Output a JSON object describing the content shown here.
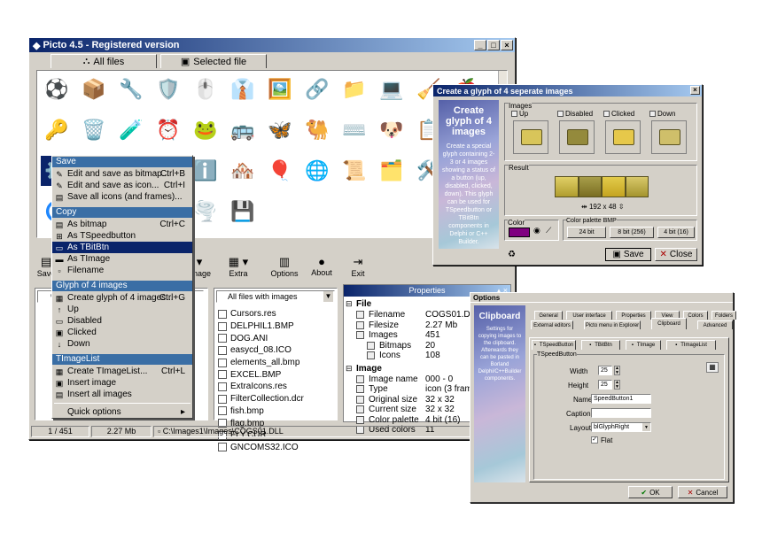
{
  "main_window": {
    "title": "Picto 4.5 - Registered version",
    "tabs": [
      {
        "label": "All files"
      },
      {
        "label": "Selected file"
      }
    ],
    "toolbar": [
      "Save",
      "Image",
      "Extra",
      "Options",
      "About",
      "Exit"
    ],
    "drive_select": "C",
    "filter_select": "All files with images",
    "files": [
      "Cursors.res",
      "DELPHIL1.BMP",
      "DOG.ANI",
      "easycd_08.ICO",
      "elements_all.bmp",
      "EXCEL.BMP",
      "ExtraIcons.res",
      "FilterCollection.dcr",
      "fish.bmp",
      "flag.bmp",
      "FLY.CUR",
      "GNCOMS32.ICO"
    ],
    "status": {
      "index": "1 / 451",
      "size": "2.27 Mb",
      "path": "C:\\Images1\\Images\\COGS01.DLL"
    },
    "icon_grid": [
      "⚽",
      "📦",
      "🔧",
      "🛡️",
      "🖱️",
      "👔",
      "🖼️",
      "🔗",
      "📁",
      "💻",
      "🧹",
      "🍎",
      "🔑",
      "🗑️",
      "🧪",
      "⏰",
      "🐸",
      "🚌",
      "🦋",
      "🐫",
      "⌨️",
      "🐶",
      "📋",
      "🧭",
      "⚙️",
      "🦅",
      "🎭",
      "💡",
      "ℹ️",
      "🏘️",
      "🎈",
      "🌐",
      "📜",
      "🗂️",
      "🛠️",
      "⚡",
      "🌀",
      "⚠️",
      "🔄",
      "🐑",
      "🌪️",
      "💾"
    ]
  },
  "properties": {
    "title": "Properties",
    "file_section": "File",
    "file_rows": [
      {
        "key": "Filename",
        "value": "COGS01.DLL"
      },
      {
        "key": "Filesize",
        "value": "2.27 Mb"
      },
      {
        "key": "Images",
        "value": "451"
      },
      {
        "key": "Bitmaps",
        "value": "20"
      },
      {
        "key": "Icons",
        "value": "108"
      }
    ],
    "image_section": "Image",
    "image_rows": [
      {
        "key": "Image name",
        "value": "000 - 0"
      },
      {
        "key": "Type",
        "value": "icon (3 frames)"
      },
      {
        "key": "Original size",
        "value": "32 x 32"
      },
      {
        "key": "Current size",
        "value": "32 x 32"
      },
      {
        "key": "Color palette",
        "value": "4 bit (16)"
      },
      {
        "key": "Used colors",
        "value": "11"
      }
    ]
  },
  "context_menu": {
    "save_header": "Save",
    "save_items": [
      {
        "label": "Edit and save as bitmap...",
        "shortcut": "Ctrl+B"
      },
      {
        "label": "Edit and save as icon...",
        "shortcut": "Ctrl+I"
      },
      {
        "label": "Save all icons (and frames)...",
        "shortcut": ""
      }
    ],
    "copy_header": "Copy",
    "copy_items": [
      {
        "label": "As bitmap",
        "shortcut": "Ctrl+C"
      },
      {
        "label": "As TSpeedbutton",
        "shortcut": ""
      },
      {
        "label": "As TBitBtn",
        "shortcut": ""
      },
      {
        "label": "As TImage",
        "shortcut": ""
      },
      {
        "label": "Filename",
        "shortcut": ""
      }
    ],
    "glyph_header": "Glyph of 4 images",
    "glyph_items": [
      {
        "label": "Create glyph of 4 images...",
        "shortcut": "Ctrl+G"
      },
      {
        "label": "Up",
        "shortcut": ""
      },
      {
        "label": "Disabled",
        "shortcut": ""
      },
      {
        "label": "Clicked",
        "shortcut": ""
      },
      {
        "label": "Down",
        "shortcut": ""
      }
    ],
    "timagelist_header": "TImageList",
    "timagelist_items": [
      {
        "label": "Create TImageList...",
        "shortcut": "Ctrl+L"
      },
      {
        "label": "Insert image",
        "shortcut": ""
      },
      {
        "label": "Insert all images",
        "shortcut": ""
      }
    ],
    "quick_options": "Quick options"
  },
  "glyph_dialog": {
    "title": "Create a glyph of 4 seperate images",
    "side_title": "Create glyph of 4 images",
    "side_text": "Create a special glyph containing 2-3 or 4 images showing a status of a button (up, disabled, clicked, down). This glyph can be used for TSpeedbutton or TBitBtn components in Delphi or C++ Builder.",
    "images_group": "Images",
    "states": [
      "Up",
      "Disabled",
      "Clicked",
      "Down"
    ],
    "result_group": "Result",
    "result_size": "192 x 48",
    "color_group": "Color",
    "palette_group": "Color palette BMP",
    "palettes": [
      "24 bit",
      "8 bit (256)",
      "4 bit (16)"
    ],
    "save": "Save",
    "close": "Close"
  },
  "options_dialog": {
    "title": "Options",
    "side_title": "Clipboard",
    "side_text": "Settings for copying images to the clipboard. Afterwards they can be pasted in Borland Delphi/C++Builder components.",
    "tabs_row1": [
      "General",
      "User interface",
      "Properties",
      "View",
      "Colors",
      "Folders"
    ],
    "tabs_row2": [
      "External editors",
      "Picto menu in Explorer",
      "Clipboard",
      "Advanced"
    ],
    "subtabs": [
      "TSpeedButton",
      "TBitBtn",
      "TImage",
      "TImageList"
    ],
    "group": "TSpeedButton",
    "width_label": "Width",
    "width_value": "25",
    "height_label": "Height",
    "height_value": "25",
    "name_label": "Name",
    "name_value": "SpeedButton1",
    "caption_label": "Caption",
    "caption_value": "",
    "layout_label": "Layout",
    "layout_value": "blGlyphRight",
    "flat_label": "Flat",
    "ok": "OK",
    "cancel": "Cancel"
  }
}
